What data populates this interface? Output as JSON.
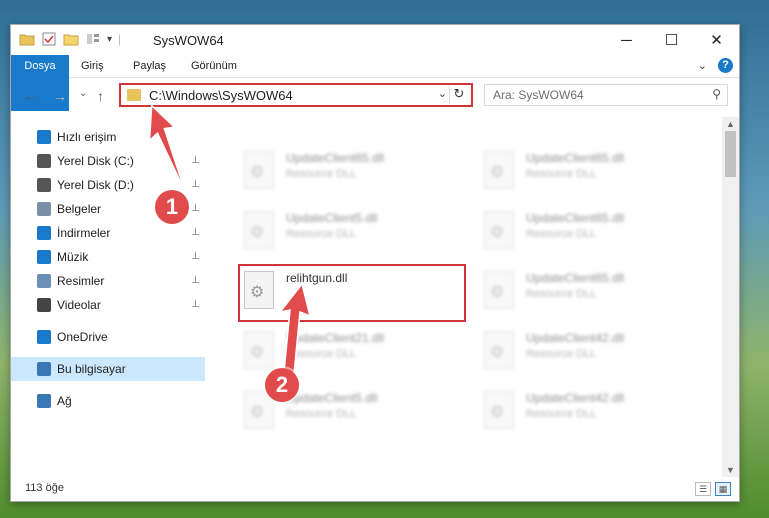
{
  "window": {
    "title": "SysWOW64"
  },
  "titlebar_buttons": {
    "minimize": "─",
    "maximize": "☐",
    "close": "✕"
  },
  "ribbon": {
    "tabs": [
      "Dosya",
      "Giriş",
      "Paylaş",
      "Görünüm"
    ],
    "help": "?"
  },
  "nav": {
    "back": "←",
    "forward": "→",
    "recent": "⌄",
    "up": "↑"
  },
  "address": {
    "path": "C:\\Windows\\SysWOW64",
    "dropdown": "⌄",
    "refresh": "↻"
  },
  "search": {
    "placeholder": "Ara: SysWOW64",
    "icon": "search-icon"
  },
  "sidebar": {
    "items": [
      {
        "label": "Hızlı erişim",
        "icon": "star-icon"
      },
      {
        "label": "Yerel Disk (C:)",
        "icon": "drive-icon",
        "pinned": true
      },
      {
        "label": "Yerel Disk (D:)",
        "icon": "drive-icon",
        "pinned": true
      },
      {
        "label": "Belgeler",
        "icon": "documents-icon",
        "pinned": true
      },
      {
        "label": "İndirmeler",
        "icon": "download-icon",
        "pinned": true
      },
      {
        "label": "Müzik",
        "icon": "music-icon",
        "pinned": true
      },
      {
        "label": "Resimler",
        "icon": "pictures-icon",
        "pinned": true
      },
      {
        "label": "Videolar",
        "icon": "videos-icon",
        "pinned": true
      },
      {
        "label": "OneDrive",
        "icon": "cloud-icon"
      },
      {
        "label": "Bu bilgisayar",
        "icon": "computer-icon",
        "selected": true
      },
      {
        "label": "Ağ",
        "icon": "network-icon"
      }
    ],
    "pin_glyph": "📌"
  },
  "files": [
    {
      "name": "UpdateClient65.dll",
      "type": "Resource DLL"
    },
    {
      "name": "UpdateClient65.dll",
      "type": "Resource DLL"
    },
    {
      "name": "UpdateClient5.dll",
      "type": "Resource DLL"
    },
    {
      "name": "UpdateClient65.dll",
      "type": "Resource DLL"
    },
    {
      "name": "relihtgun.dll",
      "type": ""
    },
    {
      "name": "UpdateClient65.dll",
      "type": "Resource DLL"
    },
    {
      "name": "UpdateClient21.dll",
      "type": "Resource DLL"
    },
    {
      "name": "UpdateClient42.dll",
      "type": "Resource DLL"
    },
    {
      "name": "UpdateClient5.dll",
      "type": "Resource DLL"
    },
    {
      "name": "UpdateClient42.dll",
      "type": "Resource DLL"
    }
  ],
  "status": {
    "count": "113 öğe"
  },
  "callouts": [
    "1",
    "2"
  ],
  "colors": {
    "accent": "#1979ca",
    "highlight": "#d13438",
    "callout": "#e24b4b",
    "selected": "#cce8ff"
  }
}
